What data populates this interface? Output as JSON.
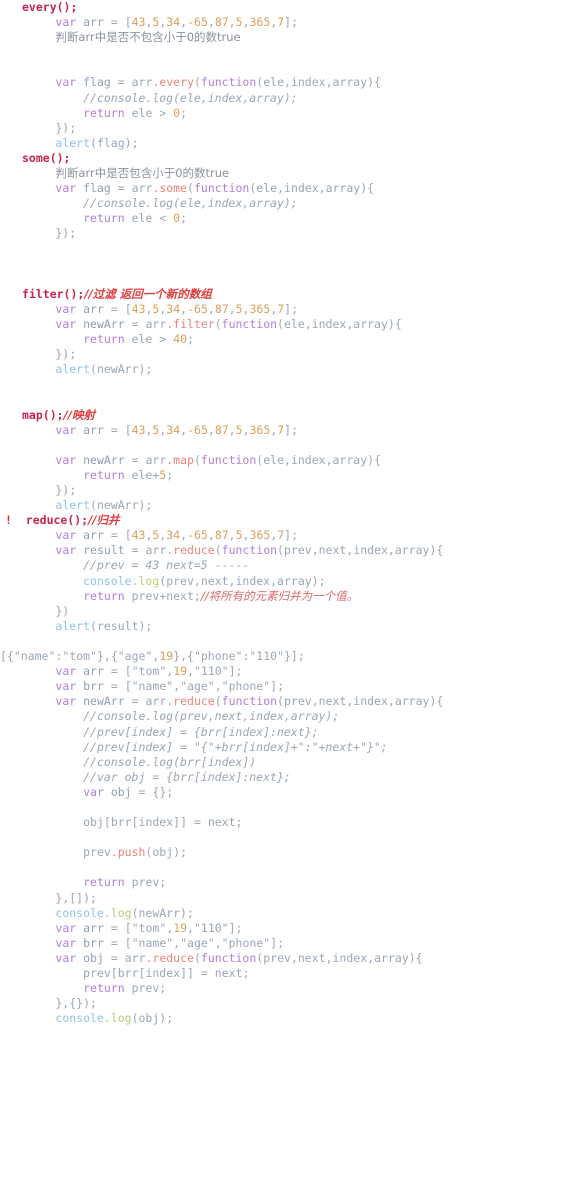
{
  "document": {
    "title": "JavaScript Array Iteration Methods Notes",
    "language": "javascript",
    "background_color": "#ffffff"
  },
  "palette": {
    "section_header": "#c7254e",
    "keyword": "#b07fd6",
    "method": "#e8857a",
    "builtin": "#8fc3e8",
    "log_method": "#b8cc7a",
    "number": "#d9a05b",
    "comment": "#9aa6b5",
    "plain": "#9aa6b5",
    "marker_bang": "#d03030",
    "chinese_comment": "#d96a6a"
  },
  "sections": [
    {
      "id": "every",
      "label": "every();",
      "marker": ""
    },
    {
      "id": "some",
      "label": "some();",
      "marker": ""
    },
    {
      "id": "filter",
      "label": "filter();",
      "comment": "//过滤 返回一个新的数组",
      "marker": ""
    },
    {
      "id": "map",
      "label": "map();",
      "comment": "//映射",
      "marker": ""
    },
    {
      "id": "reduce",
      "label": "reduce();",
      "comment": "//归并",
      "marker": "!"
    }
  ],
  "notes": [
    "判断arr中是否不包含小于0的数true",
    "判断arr中是否包含小于0的数true",
    "//将所有的元素归并为一个值。"
  ],
  "arrays": {
    "numbers": "[43,5,34,-65,87,5,365,7]",
    "values": "[\"tom\",19,\"110\"]",
    "keys": "[\"name\",\"age\",\"phone\"]",
    "objects": "[{\"name\":\"tom\"},{\"age\",19},{\"phone\":\"110\"}]"
  },
  "lines": [
    {
      "n": 1,
      "type": "header",
      "text": "every();"
    },
    {
      "n": 2,
      "type": "code",
      "text": "        var arr = [43,5,34,-65,87,5,365,7];"
    },
    {
      "n": 3,
      "type": "note",
      "text": "        判断arr中是否不包含小于0的数true"
    },
    {
      "n": 4,
      "type": "blank",
      "text": ""
    },
    {
      "n": 5,
      "type": "blank",
      "text": ""
    },
    {
      "n": 6,
      "type": "code",
      "text": "        var flag = arr.every(function(ele,index,array){"
    },
    {
      "n": 7,
      "type": "code",
      "text": "            //console.log(ele,index,array);"
    },
    {
      "n": 8,
      "type": "code",
      "text": "            return ele > 0;"
    },
    {
      "n": 9,
      "type": "code",
      "text": "        });"
    },
    {
      "n": 10,
      "type": "code",
      "text": "        alert(flag);"
    },
    {
      "n": 11,
      "type": "header",
      "text": "some();"
    },
    {
      "n": 12,
      "type": "note",
      "text": "        判断arr中是否包含小于0的数true"
    },
    {
      "n": 13,
      "type": "code",
      "text": "        var flag = arr.some(function(ele,index,array){"
    },
    {
      "n": 14,
      "type": "code",
      "text": "            //console.log(ele,index,array);"
    },
    {
      "n": 15,
      "type": "code",
      "text": "            return ele < 0;"
    },
    {
      "n": 16,
      "type": "code",
      "text": "        });"
    },
    {
      "n": 17,
      "type": "blank",
      "text": ""
    },
    {
      "n": 18,
      "type": "blank",
      "text": ""
    },
    {
      "n": 19,
      "type": "blank",
      "text": ""
    },
    {
      "n": 20,
      "type": "header",
      "text": "filter();//过滤 返回一个新的数组"
    },
    {
      "n": 21,
      "type": "code",
      "text": "        var arr = [43,5,34,-65,87,5,365,7];"
    },
    {
      "n": 22,
      "type": "code",
      "text": "        var newArr = arr.filter(function(ele,index,array){"
    },
    {
      "n": 23,
      "type": "code",
      "text": "            return ele > 40;"
    },
    {
      "n": 24,
      "type": "code",
      "text": "        });"
    },
    {
      "n": 25,
      "type": "code",
      "text": "        alert(newArr);"
    },
    {
      "n": 26,
      "type": "blank",
      "text": ""
    },
    {
      "n": 27,
      "type": "blank",
      "text": ""
    },
    {
      "n": 28,
      "type": "header",
      "text": "map();//映射"
    },
    {
      "n": 29,
      "type": "code",
      "text": "        var arr = [43,5,34,-65,87,5,365,7];"
    },
    {
      "n": 30,
      "type": "blank",
      "text": ""
    },
    {
      "n": 31,
      "type": "code",
      "text": "        var newArr = arr.map(function(ele,index,array){"
    },
    {
      "n": 32,
      "type": "code",
      "text": "            return ele+5;"
    },
    {
      "n": 33,
      "type": "code",
      "text": "        });"
    },
    {
      "n": 34,
      "type": "code",
      "text": "        alert(newArr);"
    },
    {
      "n": 35,
      "type": "header",
      "text": "reduce();//归并",
      "marker": "!"
    },
    {
      "n": 36,
      "type": "code",
      "text": "        var arr = [43,5,34,-65,87,5,365,7];"
    },
    {
      "n": 37,
      "type": "code",
      "text": "        var result = arr.reduce(function(prev,next,index,array){"
    },
    {
      "n": 38,
      "type": "code",
      "text": "            //prev = 43 next=5 -----"
    },
    {
      "n": 39,
      "type": "code",
      "text": "            console.log(prev,next,index,array);"
    },
    {
      "n": 40,
      "type": "code",
      "text": "            return prev+next;//将所有的元素归并为一个值。"
    },
    {
      "n": 41,
      "type": "code",
      "text": "        })"
    },
    {
      "n": 42,
      "type": "code",
      "text": "        alert(result);"
    },
    {
      "n": 43,
      "type": "blank",
      "text": ""
    },
    {
      "n": 44,
      "type": "code",
      "text": "[{\"name\":\"tom\"},{\"age\",19},{\"phone\":\"110\"}];"
    },
    {
      "n": 45,
      "type": "code",
      "text": "        var arr = [\"tom\",19,\"110\"];"
    },
    {
      "n": 46,
      "type": "code",
      "text": "        var brr = [\"name\",\"age\",\"phone\"];"
    },
    {
      "n": 47,
      "type": "code",
      "text": "        var newArr = arr.reduce(function(prev,next,index,array){"
    },
    {
      "n": 48,
      "type": "code",
      "text": "            //console.log(prev,next,index,array);"
    },
    {
      "n": 49,
      "type": "code",
      "text": "            //prev[index] = {brr[index]:next};"
    },
    {
      "n": 50,
      "type": "code",
      "text": "            //prev[index] = \"{\"+brr[index]+\":\"+next+\"}\";"
    },
    {
      "n": 51,
      "type": "code",
      "text": "            //console.log(brr[index])"
    },
    {
      "n": 52,
      "type": "code",
      "text": "            //var obj = {brr[index]:next};"
    },
    {
      "n": 53,
      "type": "code",
      "text": "            var obj = {};"
    },
    {
      "n": 54,
      "type": "blank",
      "text": ""
    },
    {
      "n": 55,
      "type": "code",
      "text": "            obj[brr[index]] = next;"
    },
    {
      "n": 56,
      "type": "blank",
      "text": ""
    },
    {
      "n": 57,
      "type": "code",
      "text": "            prev.push(obj);"
    },
    {
      "n": 58,
      "type": "blank",
      "text": ""
    },
    {
      "n": 59,
      "type": "code",
      "text": "            return prev;"
    },
    {
      "n": 60,
      "type": "code",
      "text": "        },[]);"
    },
    {
      "n": 61,
      "type": "code",
      "text": "        console.log(newArr);"
    },
    {
      "n": 62,
      "type": "code",
      "text": "        var arr = [\"tom\",19,\"110\"];"
    },
    {
      "n": 63,
      "type": "code",
      "text": "        var brr = [\"name\",\"age\",\"phone\"];"
    },
    {
      "n": 64,
      "type": "code",
      "text": "        var obj = arr.reduce(function(prev,next,index,array){"
    },
    {
      "n": 65,
      "type": "code",
      "text": "            prev[brr[index]] = next;"
    },
    {
      "n": 66,
      "type": "code",
      "text": "            return prev;"
    },
    {
      "n": 67,
      "type": "code",
      "text": "        },{});"
    },
    {
      "n": 68,
      "type": "code",
      "text": "        console.log(obj);"
    }
  ]
}
